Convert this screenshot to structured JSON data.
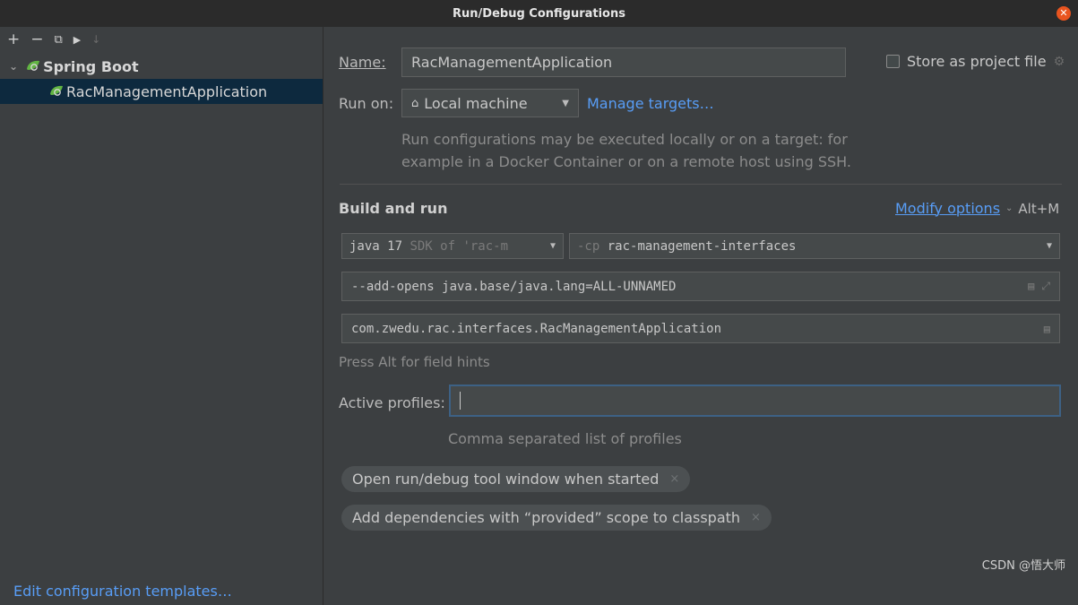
{
  "window": {
    "title": "Run/Debug Configurations",
    "close_glyph": "✕"
  },
  "toolbar": {
    "icons": [
      "add-icon",
      "remove-icon",
      "copy-icon",
      "move-into-folder-icon",
      "sort-icon"
    ],
    "glyphs": {
      "add": "+",
      "remove": "−",
      "copy": "⧉",
      "folder": "▶",
      "sort": "↓"
    }
  },
  "tree": {
    "group": {
      "label": "Spring Boot",
      "expanded": true,
      "chevron": "⌄",
      "icon": "spring-boot-icon"
    },
    "items": [
      {
        "label": "RacManagementApplication",
        "selected": true,
        "icon": "spring-boot-icon"
      }
    ]
  },
  "footer": {
    "edit_templates_label": "Edit configuration templates…"
  },
  "form": {
    "name_label": "Name:",
    "name_value": "RacManagementApplication",
    "store_label": "Store as project file",
    "store_checked": false,
    "run_on_label": "Run on:",
    "run_on_value": "Local machine",
    "manage_targets_label": "Manage targets…",
    "run_on_hint_line1": "Run configurations may be executed locally or on a target: for",
    "run_on_hint_line2": "example in a Docker Container or on a remote host using SSH.",
    "build_run_heading": "Build and run",
    "modify_options_label": "Modify options",
    "modify_shortcut": "Alt+M",
    "jre_value": "java 17",
    "jre_detail": "SDK of 'rac-m",
    "cp_prefix": "-cp",
    "cp_value": "rac-management-interfaces",
    "vm_options_value": "--add-opens java.base/java.lang=ALL-UNNAMED",
    "main_class_value": "com.zwedu.rac.interfaces.RacManagementApplication",
    "field_hints_text": "Press Alt for field hints",
    "active_profiles_label": "Active profiles:",
    "active_profiles_value": "",
    "active_profiles_hint": "Comma separated list of profiles",
    "chips": [
      {
        "label": "Open run/debug tool window when started",
        "close": "×"
      },
      {
        "label": "Add dependencies with “provided” scope to classpath",
        "close": "×"
      }
    ]
  },
  "watermark": "CSDN @悟大师",
  "colors": {
    "accent": "#589df6",
    "selection": "#0d293e",
    "spring_green": "#62b543",
    "close": "#e9541f"
  }
}
